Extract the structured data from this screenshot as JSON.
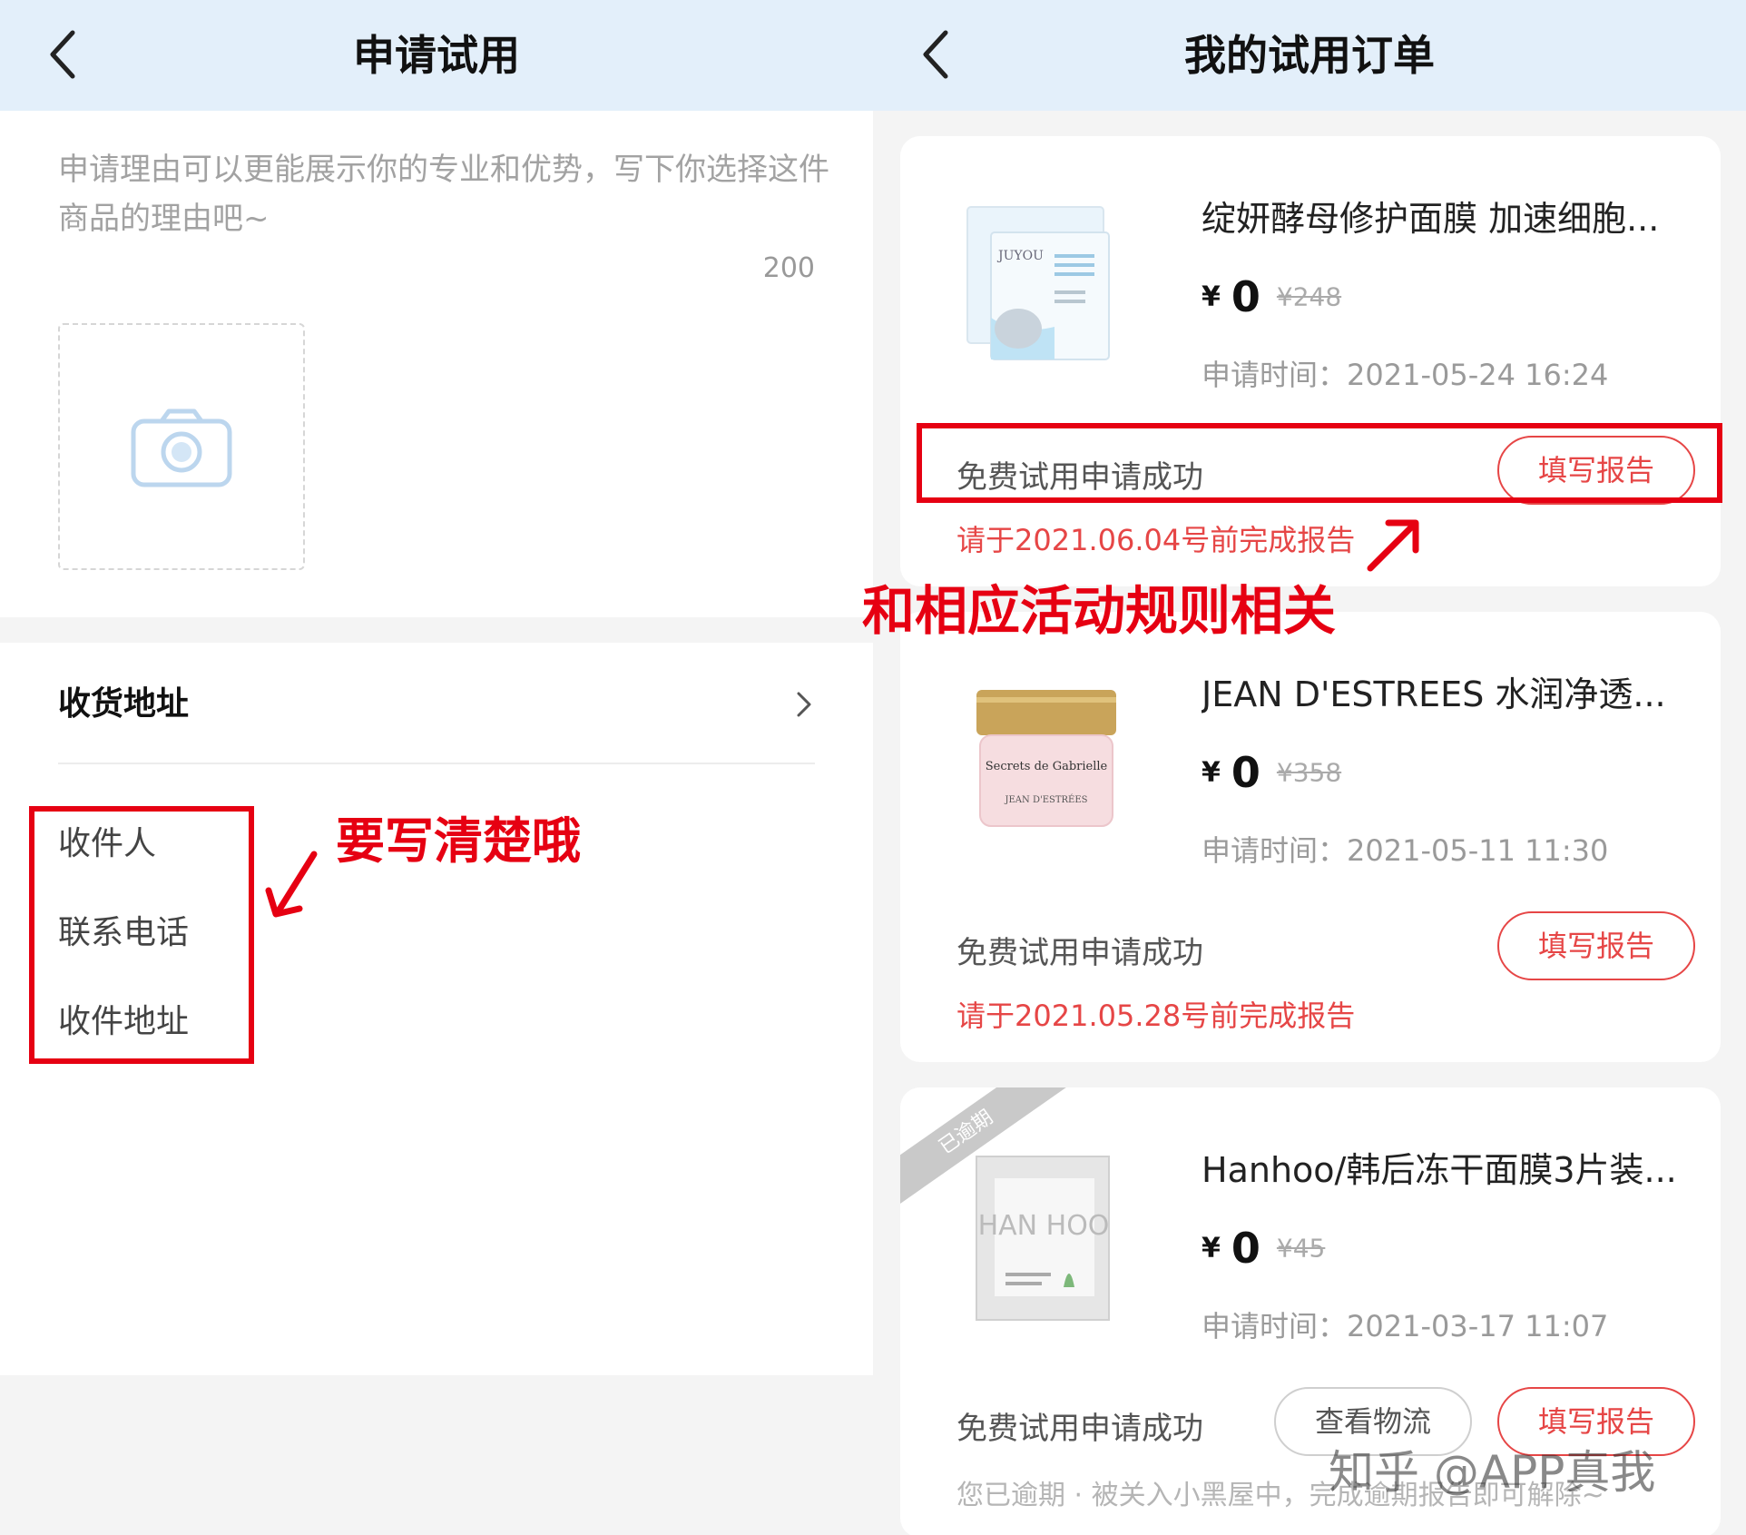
{
  "left": {
    "title": "申请试用",
    "reason_placeholder": "申请理由可以更能展示你的专业和优势，写下你选择这件商品的理由吧~",
    "char_limit": "200",
    "address_section_title": "收货地址",
    "fields": [
      "收件人",
      "联系电话",
      "收件地址"
    ],
    "annotation": "要写清楚哦"
  },
  "right": {
    "title": "我的试用订单",
    "annotation": "和相应活动规则相关",
    "orders": [
      {
        "name": "绽妍酵母修护面膜 加速细胞...",
        "currency": "¥",
        "price": "0",
        "original_price": "¥248",
        "apply_time": "申请时间：2021-05-24 16:24",
        "status": "免费试用申请成功",
        "report_button": "填写报告",
        "deadline": "请于2021.06.04号前完成报告"
      },
      {
        "name": "JEAN D'ESTREES 水润净透...",
        "currency": "¥",
        "price": "0",
        "original_price": "¥358",
        "apply_time": "申请时间：2021-05-11 11:30",
        "status": "免费试用申请成功",
        "report_button": "填写报告",
        "deadline": "请于2021.05.28号前完成报告"
      },
      {
        "ribbon": "已逾期",
        "name": "Hanhoo/韩后冻干面膜3片装...",
        "currency": "¥",
        "price": "0",
        "original_price": "¥45",
        "apply_time": "申请时间：2021-03-17 11:07",
        "status": "免费试用申请成功",
        "logistics_button": "查看物流",
        "report_button": "填写报告",
        "overdue_note": "您已逾期 · 被关入小黑屋中，完成逾期报告即可解除~"
      }
    ],
    "watermark": "知乎 @APP真我"
  },
  "product_images": {
    "order_1": {
      "brand_text": "JUYOU",
      "color": "#bfe3f5"
    },
    "order_2": {
      "brand_text": "Secrets de Gabrielle",
      "subtext": "JEAN D'ESTRÉES",
      "color": "#f6dde0"
    },
    "order_3": {
      "brand_text": "HAN HOO",
      "color": "#e6e6e6"
    }
  },
  "colors": {
    "accent_red": "#e64646",
    "annotation_red": "#e60012",
    "topbar_bg": "#e3effa"
  }
}
